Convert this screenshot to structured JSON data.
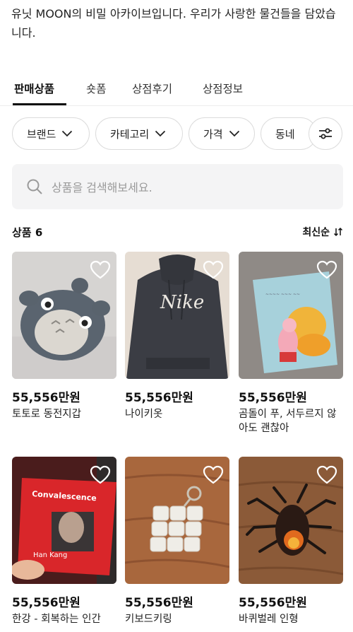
{
  "intro": "유닛 MOON의 비밀 아카이브입니다. 우리가 사랑한 물건들을 담았습니다.",
  "tabs": [
    {
      "label": "판매상품",
      "active": true
    },
    {
      "label": "숏폼",
      "active": false
    },
    {
      "label": "상점후기",
      "active": false
    },
    {
      "label": "상점정보",
      "active": false
    }
  ],
  "filters": [
    {
      "label": "브랜드",
      "icon": "chevron-down-icon"
    },
    {
      "label": "카테고리",
      "icon": "chevron-down-icon"
    },
    {
      "label": "가격",
      "icon": "chevron-down-icon"
    },
    {
      "label": "동네"
    }
  ],
  "filter_icon": "sliders-icon",
  "search": {
    "placeholder": "상품을 검색해보세요.",
    "icon": "search-icon"
  },
  "product_count_label": "상품 6",
  "sort": {
    "label": "최신순",
    "icon": "sort-icon"
  },
  "products": [
    {
      "price": "55,556만원",
      "name": "토토로 동전지갑",
      "image": "totoro-coin-purse",
      "liked": false
    },
    {
      "price": "55,556만원",
      "name": "나이키옷",
      "image": "nike-hoodie",
      "liked": false
    },
    {
      "price": "55,556만원",
      "name": "곰돌이 푸, 서두르지 않아도 괜찮아",
      "image": "pooh-book",
      "liked": false
    },
    {
      "price": "55,556만원",
      "name": "한강 - 회복하는 인간",
      "image": "convalescence-book",
      "liked": false
    },
    {
      "price": "55,556만원",
      "name": "키보드키링",
      "image": "keyboard-keyring",
      "liked": false
    },
    {
      "price": "55,556만원",
      "name": "바퀴벌레 인형",
      "image": "cockroach-toy",
      "liked": false
    }
  ],
  "colors": {
    "text": "#111111",
    "muted": "#9a9a9a",
    "search_bg": "#f4f4f5",
    "border": "#dcdcdc"
  }
}
